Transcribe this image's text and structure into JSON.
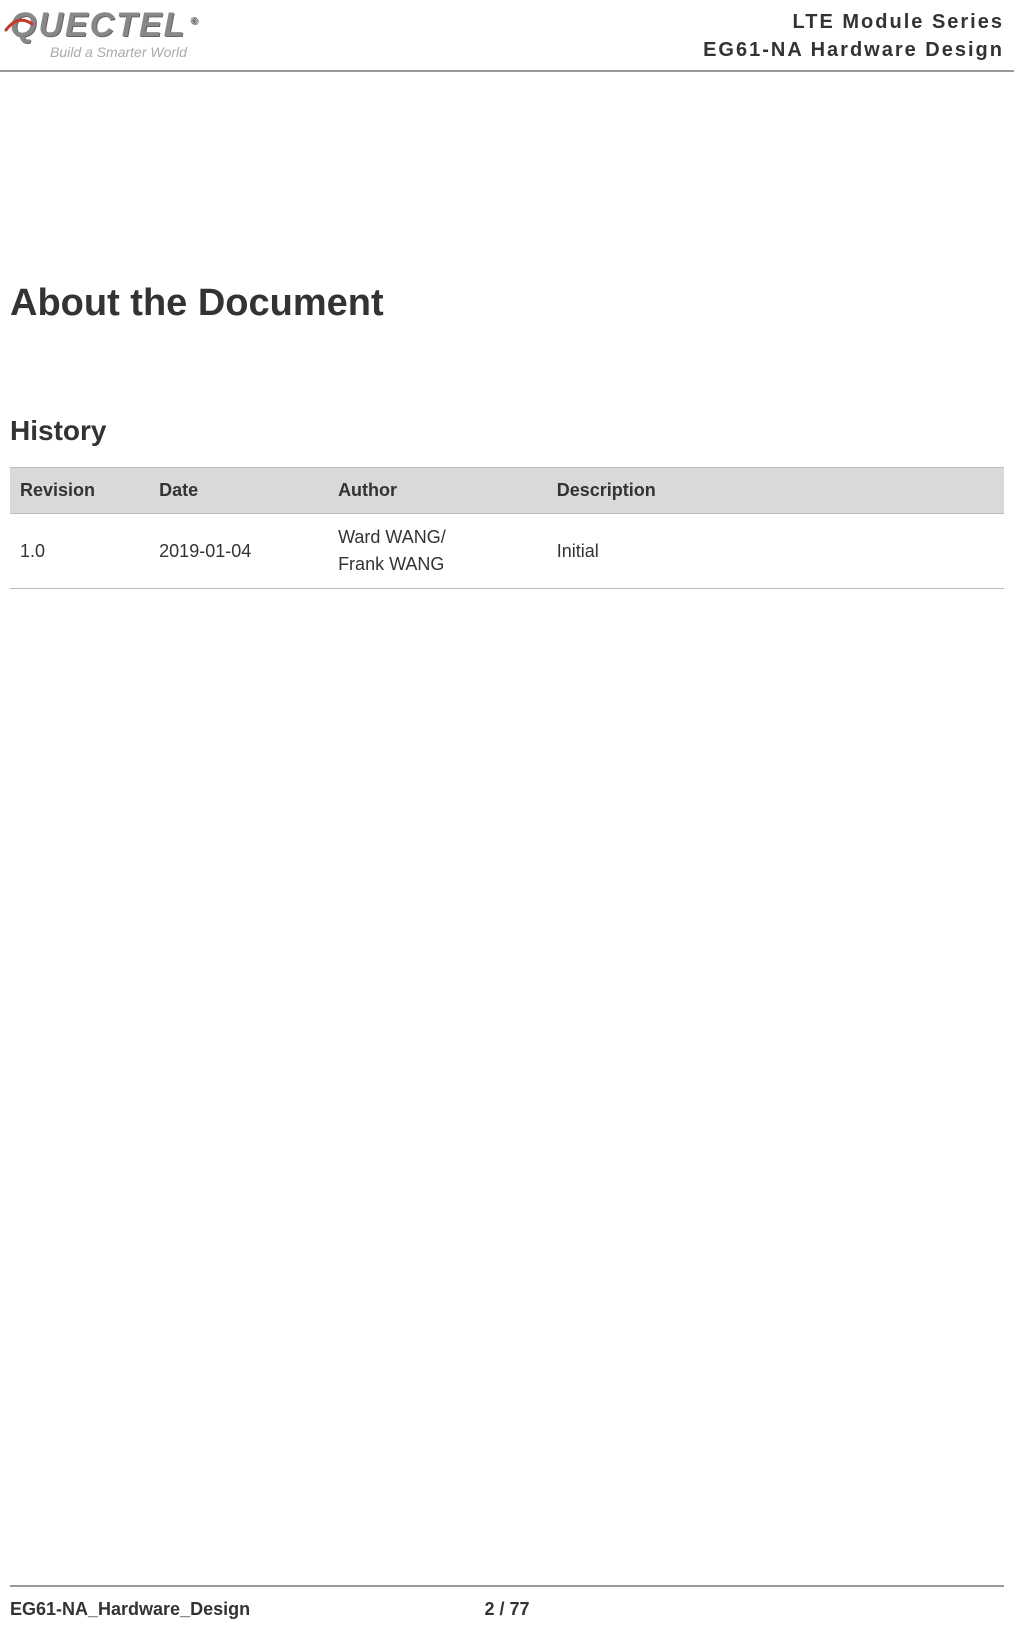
{
  "header": {
    "logo_text": "QUECTEL",
    "logo_reg": "®",
    "tagline": "Build a Smarter World",
    "series_line": "LTE  Module  Series",
    "product_line": "EG61-NA  Hardware  Design"
  },
  "title": "About the Document",
  "history": {
    "heading": "History",
    "columns": {
      "revision": "Revision",
      "date": "Date",
      "author": "Author",
      "description": "Description"
    },
    "rows": [
      {
        "revision": "1.0",
        "date": "2019-01-04",
        "author": "Ward WANG/\nFrank WANG",
        "description": "Initial"
      }
    ]
  },
  "footer": {
    "doc": "EG61-NA_Hardware_Design",
    "page": "2 / 77"
  }
}
